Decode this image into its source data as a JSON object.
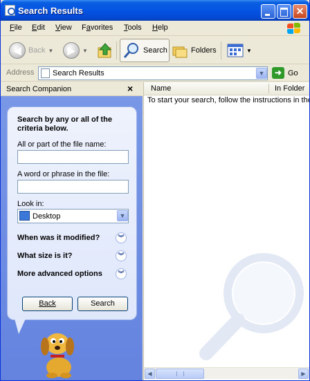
{
  "window": {
    "title": "Search Results",
    "title_icon": "search-results-icon"
  },
  "menu": {
    "items": [
      {
        "label": "File",
        "key": "F",
        "rest": "ile"
      },
      {
        "label": "Edit",
        "key": "E",
        "rest": "dit"
      },
      {
        "label": "View",
        "key": "V",
        "rest": "iew"
      },
      {
        "label": "Favorites",
        "key": "a",
        "rest": "vorites",
        "pre": "F"
      },
      {
        "label": "Tools",
        "key": "T",
        "rest": "ools"
      },
      {
        "label": "Help",
        "key": "H",
        "rest": "elp"
      }
    ]
  },
  "toolbar": {
    "back_label": "Back",
    "search_label": "Search",
    "folders_label": "Folders"
  },
  "address": {
    "label": "Address",
    "value": "Search Results",
    "go_label": "Go"
  },
  "companion": {
    "title": "Search Companion",
    "close_glyph": "×",
    "intro": "Search by any or all of the criteria below.",
    "file_name_label": "All or part of the file name:",
    "file_name_value": "",
    "phrase_label": "A word or phrase in the file:",
    "phrase_value": "",
    "look_in_label": "Look in:",
    "look_in_value": "Desktop",
    "options": [
      "When was it modified?",
      "What size is it?",
      "More advanced options"
    ],
    "back_button": "Back",
    "search_button": "Search"
  },
  "results": {
    "columns": [
      "Name",
      "In Folder"
    ],
    "message": "To start your search, follow the instructions in the left pane."
  },
  "colors": {
    "title_bar": "#0554e3",
    "companion_bg": "#7a98e6",
    "chrome": "#ece9d8"
  }
}
